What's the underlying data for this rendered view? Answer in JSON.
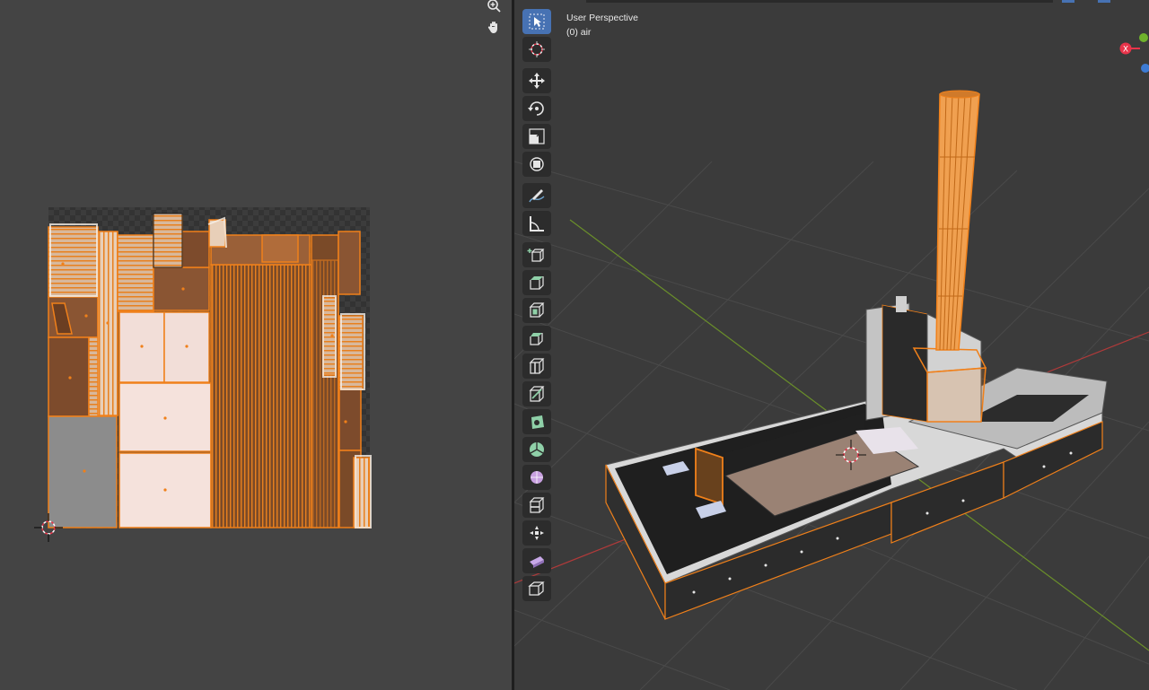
{
  "viewport": {
    "view_name": "User Perspective",
    "object_label": "(0) air"
  },
  "uv_editor": {
    "nav_icons": [
      "zoom-icon",
      "hand-pan-icon"
    ]
  },
  "toolbar": {
    "tools": [
      {
        "name": "select-box",
        "active": true
      },
      {
        "name": "cursor"
      },
      {
        "name": "move"
      },
      {
        "name": "rotate"
      },
      {
        "name": "scale"
      },
      {
        "name": "transform"
      },
      {
        "name": "annotate"
      },
      {
        "name": "measure"
      },
      {
        "name": "add-cube"
      },
      {
        "name": "extrude-region"
      },
      {
        "name": "inset-faces"
      },
      {
        "name": "bevel"
      },
      {
        "name": "loop-cut"
      },
      {
        "name": "knife"
      },
      {
        "name": "poly-build"
      },
      {
        "name": "spin"
      },
      {
        "name": "smooth"
      },
      {
        "name": "edge-slide"
      },
      {
        "name": "shrink-fatten"
      },
      {
        "name": "shear"
      },
      {
        "name": "rip-region"
      }
    ]
  },
  "gizmo": {
    "x_axis_label": "X",
    "colors": {
      "x": "#e8344a",
      "y": "#6fb22c",
      "z": "#3d7bd4"
    }
  },
  "colors": {
    "accent_selection": "#f0801a",
    "active_tool": "#4772b3",
    "grid_x_axis": "#b03a3a",
    "grid_y_axis": "#6a8f2a"
  }
}
